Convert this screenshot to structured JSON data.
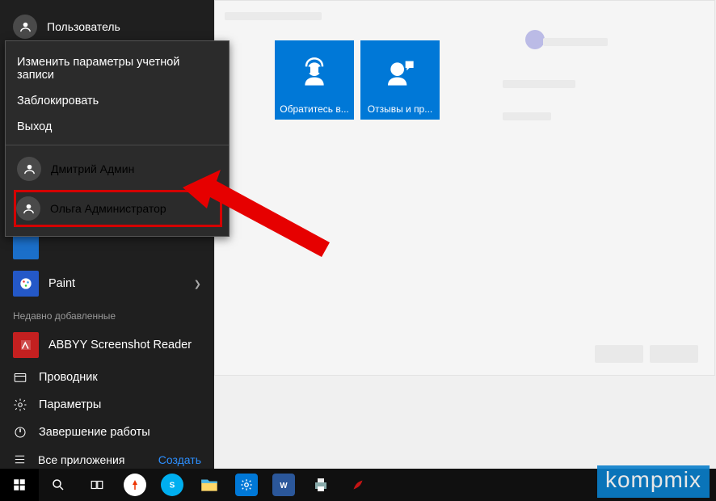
{
  "user": {
    "name": "Пользователь"
  },
  "flyout": {
    "change_account": "Изменить параметры учетной записи",
    "lock": "Заблокировать",
    "signout": "Выход",
    "users": [
      {
        "name": "Дмитрий Админ"
      },
      {
        "name": "Ольга Администратор"
      }
    ]
  },
  "most_used": {
    "paint": "Paint",
    "recently_added_label": "Недавно добавленные",
    "abbyy": "ABBYY Screenshot Reader"
  },
  "bottom": {
    "explorer": "Проводник",
    "settings": "Параметры",
    "power": "Завершение работы",
    "all_apps": "Все приложения",
    "create": "Создать"
  },
  "tiles": [
    {
      "label": "Обратитесь в..."
    },
    {
      "label": "Отзывы и пр..."
    }
  ],
  "watermark": "kompmix"
}
